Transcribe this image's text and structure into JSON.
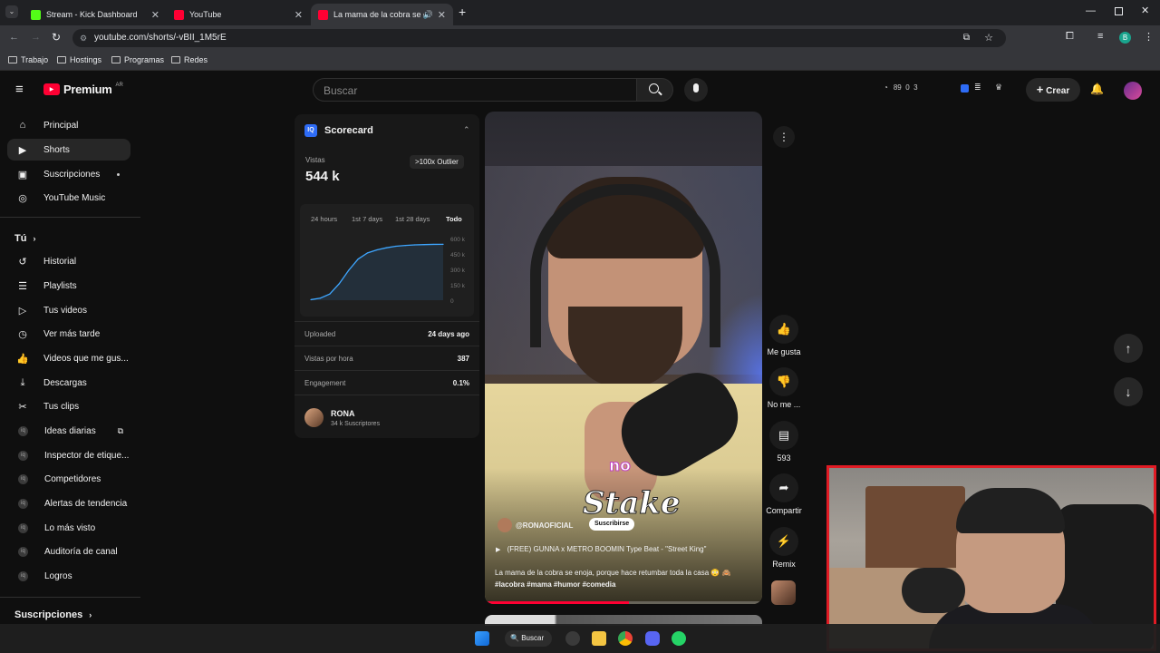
{
  "browser": {
    "tabs": [
      {
        "title": "Stream - Kick Dashboard",
        "color": "#53fc18"
      },
      {
        "title": "YouTube",
        "color": "#ff0033"
      },
      {
        "title": "La mama de la cobra se en",
        "color": "#ff0033"
      }
    ],
    "url": "youtube.com/shorts/-vBII_1M5rE",
    "bookmarks": [
      "Trabajo",
      "Hostings",
      "Programas",
      "Redes"
    ]
  },
  "header": {
    "logo": "Premium",
    "region": "AR",
    "search_placeholder": "Buscar",
    "stats": "89  0  3",
    "create_label": "Crear"
  },
  "sidebar": {
    "items": [
      {
        "label": "Principal",
        "icon": "home-icon"
      },
      {
        "label": "Shorts",
        "icon": "shorts-icon"
      },
      {
        "label": "Suscripciones",
        "icon": "subscriptions-icon"
      },
      {
        "label": "YouTube Music",
        "icon": "music-icon"
      }
    ],
    "you_header": "Tú",
    "you_items": [
      {
        "label": "Historial",
        "icon": "history-icon"
      },
      {
        "label": "Playlists",
        "icon": "playlist-icon"
      },
      {
        "label": "Tus videos",
        "icon": "video-icon"
      },
      {
        "label": "Ver más tarde",
        "icon": "clock-icon"
      },
      {
        "label": "Videos que me gus...",
        "icon": "thumbs-up-icon"
      },
      {
        "label": "Descargas",
        "icon": "download-icon"
      },
      {
        "label": "Tus clips",
        "icon": "scissors-icon"
      }
    ],
    "tool_items": [
      {
        "label": "Ideas diarias"
      },
      {
        "label": "Inspector de etique..."
      },
      {
        "label": "Competidores"
      },
      {
        "label": "Alertas de tendencia"
      },
      {
        "label": "Lo más visto"
      },
      {
        "label": "Auditoría de canal"
      },
      {
        "label": "Logros"
      }
    ],
    "subs_header": "Suscripciones"
  },
  "scorecard": {
    "title": "Scorecard",
    "views_label": "Vistas",
    "views_value": "544 k",
    "outlier_badge": ">100x Outlier",
    "ranges": [
      "24 hours",
      "1st 7 days",
      "1st 28 days",
      "Todo"
    ],
    "active_range": "Todo",
    "y_ticks": [
      "600 k",
      "450 k",
      "300 k",
      "150 k",
      "0"
    ],
    "rows": [
      {
        "label": "Uploaded",
        "value": "24 days ago"
      },
      {
        "label": "Vistas por hora",
        "value": "387"
      },
      {
        "label": "Engagement",
        "value": "0.1%"
      }
    ],
    "channel_name": "RONA",
    "channel_subs": "34 k Suscriptores"
  },
  "chart_data": {
    "type": "area",
    "x": [
      0,
      1,
      2,
      3,
      4,
      5,
      6,
      7,
      8,
      9,
      10,
      11,
      12,
      13,
      14
    ],
    "values": [
      5,
      20,
      60,
      160,
      290,
      400,
      460,
      490,
      510,
      525,
      533,
      538,
      541,
      543,
      544
    ],
    "ylabel": "",
    "ylim": [
      0,
      600
    ],
    "y_ticks": [
      "600 k",
      "450 k",
      "300 k",
      "150 k",
      "0"
    ],
    "color": "#3ea6ff"
  },
  "video": {
    "caption_word": "no",
    "sponsor": "Stake",
    "channel_handle": "@RONAOFICIAL",
    "subscribe_label": "Suscribirse",
    "music": "(FREE) GUNNA x METRO BOOMIN Type Beat - \"Street King\"",
    "description": "La mama de la cobra se enoja, porque hace retumbar toda la casa",
    "hashtags": "#lacobra #mama #humor #comedia",
    "progress": 0.52
  },
  "actions": {
    "like": "Me gusta",
    "dislike": "No me ...",
    "comments": "593",
    "share": "Compartir",
    "remix": "Remix"
  },
  "taskbar": {
    "search_label": "Buscar"
  }
}
